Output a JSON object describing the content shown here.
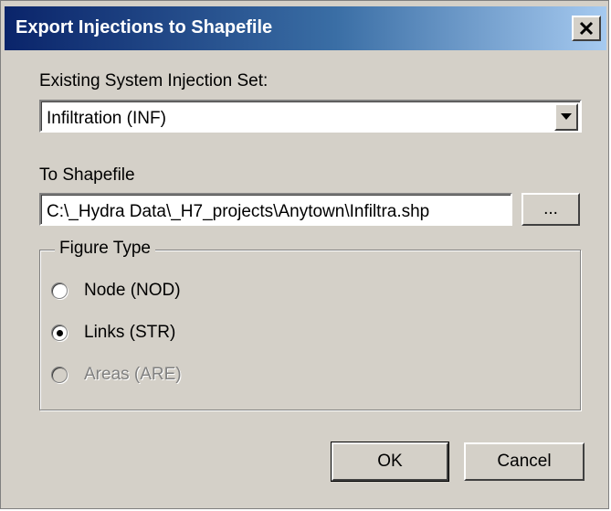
{
  "window": {
    "title": "Export Injections to Shapefile",
    "close_glyph": "✕"
  },
  "injection_set": {
    "label": "Existing System Injection Set:",
    "selected": "Infiltration (INF)"
  },
  "shapefile": {
    "label": "To Shapefile",
    "value": "C:\\_Hydra Data\\_H7_projects\\Anytown\\Infiltra.shp",
    "browse_label": "..."
  },
  "figure_type": {
    "title": "Figure Type",
    "options": [
      {
        "label": "Node (NOD)",
        "checked": false,
        "enabled": true
      },
      {
        "label": "Links (STR)",
        "checked": true,
        "enabled": true
      },
      {
        "label": "Areas (ARE)",
        "checked": false,
        "enabled": false
      }
    ]
  },
  "buttons": {
    "ok": "OK",
    "cancel": "Cancel"
  },
  "colors": {
    "titlebar_start": "#0a246a",
    "titlebar_end": "#a6caf0",
    "face": "#d4d0c8"
  }
}
